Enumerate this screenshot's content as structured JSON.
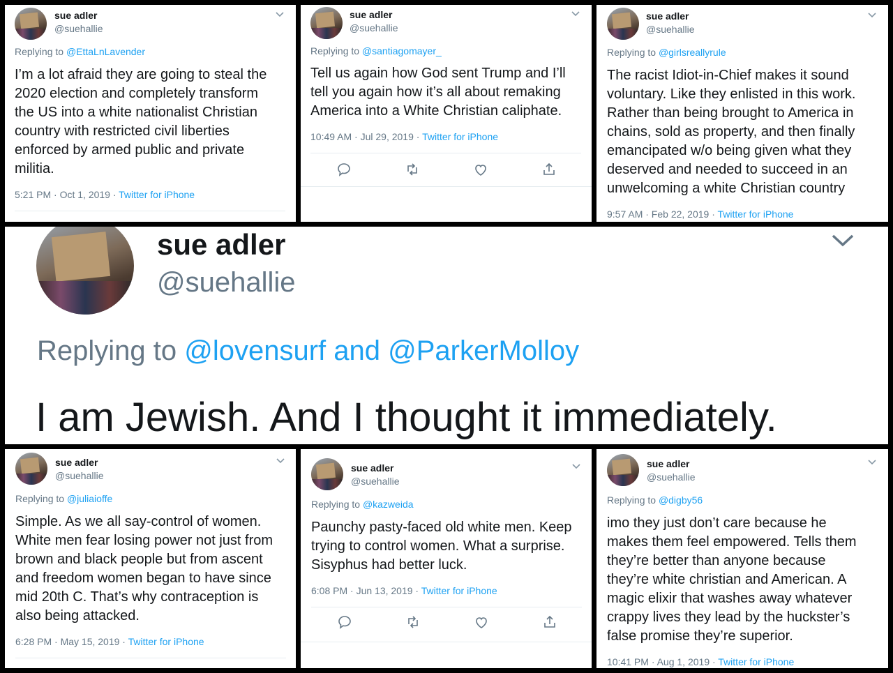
{
  "tweets": [
    {
      "name": "sue adler",
      "handle": "@suehallie",
      "replying_prefix": "Replying to ",
      "replying_to": "@EttaLnLavender",
      "text": "I’m a lot afraid they are going to steal the\n2020 election and completely transform\nthe US into a white nationalist Christian\ncountry with restricted civil liberties\nenforced by armed public and private\nmilitia.",
      "time": "5:21 PM · Oct 1, 2019 · ",
      "source": "Twitter for iPhone"
    },
    {
      "name": "sue adler",
      "handle": "@suehallie",
      "replying_prefix": "Replying to ",
      "replying_to": "@santiagomayer_",
      "text": "Tell us again how God sent Trump and I’ll\ntell you again how it’s all about remaking\nAmerica into a White Christian caliphate.",
      "time": "10:49 AM · Jul 29, 2019 · ",
      "source": "Twitter for iPhone"
    },
    {
      "name": "sue adler",
      "handle": "@suehallie",
      "replying_prefix": "Replying to ",
      "replying_to": "@girlsreallyrule",
      "text": "The racist Idiot-in-Chief makes it sound\nvoluntary. Like they enlisted in this work.\nRather than being brought to America in\nchains, sold as property, and then finally\nemancipated w/o being given what they\ndeserved and needed to succeed in an\nunwelcoming a white Christian country",
      "time": "9:57 AM · Feb 22, 2019 · ",
      "source": "Twitter for iPhone"
    },
    {
      "name": "sue adler",
      "handle": "@suehallie",
      "replying_prefix": "Replying to ",
      "replying_to": "@lovensurf and @ParkerMolloy",
      "text": "I am Jewish. And I thought it immediately."
    },
    {
      "name": "sue adler",
      "handle": "@suehallie",
      "replying_prefix": "Replying to ",
      "replying_to": "@juliaioffe",
      "text": "Simple. As we all say-control of women.\nWhite men fear losing power not just from\nbrown and black people but from ascent\nand freedom women began to have since\nmid 20th C. That’s why contraception is\nalso being attacked.",
      "time": "6:28 PM · May 15, 2019 · ",
      "source": "Twitter for iPhone"
    },
    {
      "name": "sue adler",
      "handle": "@suehallie",
      "replying_prefix": "Replying to ",
      "replying_to": "@kazweida",
      "text": "Paunchy pasty-faced old white men. Keep\ntrying to control women. What a surprise.\nSisyphus had better luck.",
      "time": "6:08 PM · Jun 13, 2019 · ",
      "source": "Twitter for iPhone"
    },
    {
      "name": "sue adler",
      "handle": "@suehallie",
      "replying_prefix": "Replying to ",
      "replying_to": "@digby56",
      "text": "imo they just don’t care because he\nmakes them feel empowered. Tells them\nthey’re better than anyone because\nthey’re white christian and American. A\nmagic elixir that washes away whatever\ncrappy lives they lead by the huckster’s\nfalse promise they’re superior.",
      "time": "10:41 PM · Aug 1, 2019 · ",
      "source": "Twitter for iPhone"
    }
  ],
  "icons": {
    "caret": "chevron-down-icon",
    "reply": "reply-icon",
    "retweet": "retweet-icon",
    "like": "like-icon",
    "share": "share-icon"
  },
  "colors": {
    "link": "#1da1f2",
    "secondary": "#657786",
    "text": "#14171a",
    "background": "#000000"
  }
}
